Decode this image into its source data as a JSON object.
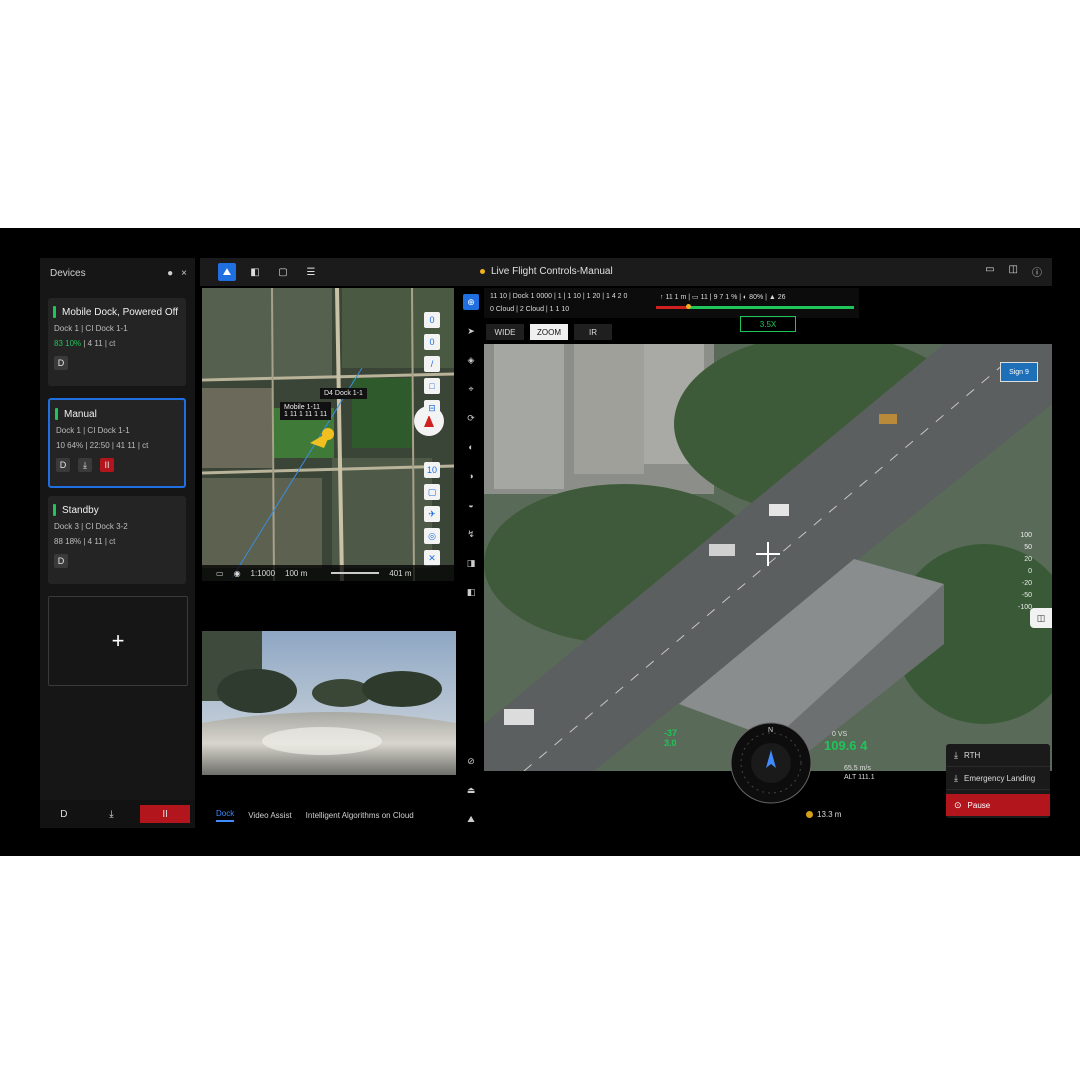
{
  "devices": {
    "title": "Devices",
    "header_icons": [
      "●",
      "×"
    ],
    "cards": [
      {
        "name": "Mobile Dock, Powered Off",
        "line1": "Dock 1 | CI Dock 1-1",
        "line2_green": "83 10%",
        "line2": "| 4 11 | ct",
        "actions": [
          "D"
        ]
      },
      {
        "name": "Manual",
        "line1": "Dock 1 | CI Dock 1-1",
        "line2": "10 64% | 22:50 | 41 11 | ct",
        "actions": [
          "D",
          "⤓",
          "II"
        ]
      },
      {
        "name": "Standby",
        "line1": "Dock 3 | CI Dock 3-2",
        "line2": "88 18% | 4 11 | ct",
        "actions": [
          "D"
        ]
      }
    ],
    "add_label": "+",
    "footer": [
      "D",
      "⤓",
      "II"
    ]
  },
  "topbar": {
    "title": "Live Flight Controls-Manual",
    "left_icons": [
      "⛰",
      "◧",
      "▢",
      "☰"
    ],
    "right_icons": [
      "▭",
      "◫",
      "ⓘ"
    ]
  },
  "map": {
    "label_main": "Mobile 1-11",
    "label_sub": "1 11 1 11 1 11",
    "label_other": "D4 Dock 1-1",
    "status": [
      "▭",
      "◉",
      "1:1000",
      "100 m",
      "401 m"
    ],
    "tools": [
      "0",
      "0",
      "/",
      "□",
      "⊟",
      "10",
      "▢",
      "✈",
      "◎",
      "✕"
    ]
  },
  "dock_tabs": [
    "Dock",
    "Video Assist",
    "Intelligent Algorithms on Cloud"
  ],
  "vertical_tools": [
    "⊕",
    "➤",
    "◈",
    "⌖",
    "⟳",
    "◐",
    "◑",
    "◒",
    "↯",
    "◨",
    "◧",
    "⊘",
    "⏏",
    "⛰"
  ],
  "camera": {
    "row1": "11 10 | Dock 1 0000 | 1 | 1 10 | 1 20 | 1 4 2 0",
    "row2": "0 Cloud | 2 Cloud | 1 1 10",
    "telemetry": "↑ 11 1 m | ▭ 11 | 9 7 1 % | ◐ 80% | ▲ 26",
    "lenses": [
      "WIDE",
      "ZOOM",
      "IR"
    ],
    "active_lens": 1,
    "zoom": "3.5X"
  },
  "aerial": {
    "sign": "Sign 9",
    "ruler": [
      "100",
      "50",
      "20",
      "0",
      "-20",
      "-50",
      "-100"
    ]
  },
  "hud": {
    "speed_left": "-37",
    "speed_left_unit": "3.0",
    "alt_right": "109.6 4",
    "alt_right_sub": [
      "65.5 m/s",
      "ALT 111.1"
    ],
    "alt_label": "0 VS",
    "rssi": "13.3 m"
  },
  "actions_menu": {
    "items": [
      {
        "icon": "⤓",
        "label": "RTH"
      },
      {
        "icon": "⤓",
        "label": "Emergency Landing"
      },
      {
        "icon": "⊙",
        "label": "Pause"
      }
    ]
  },
  "colors": {
    "accent": "#1f6fe0",
    "ok": "#1fc45a",
    "danger": "#b3151d",
    "warning": "#f0b020"
  }
}
